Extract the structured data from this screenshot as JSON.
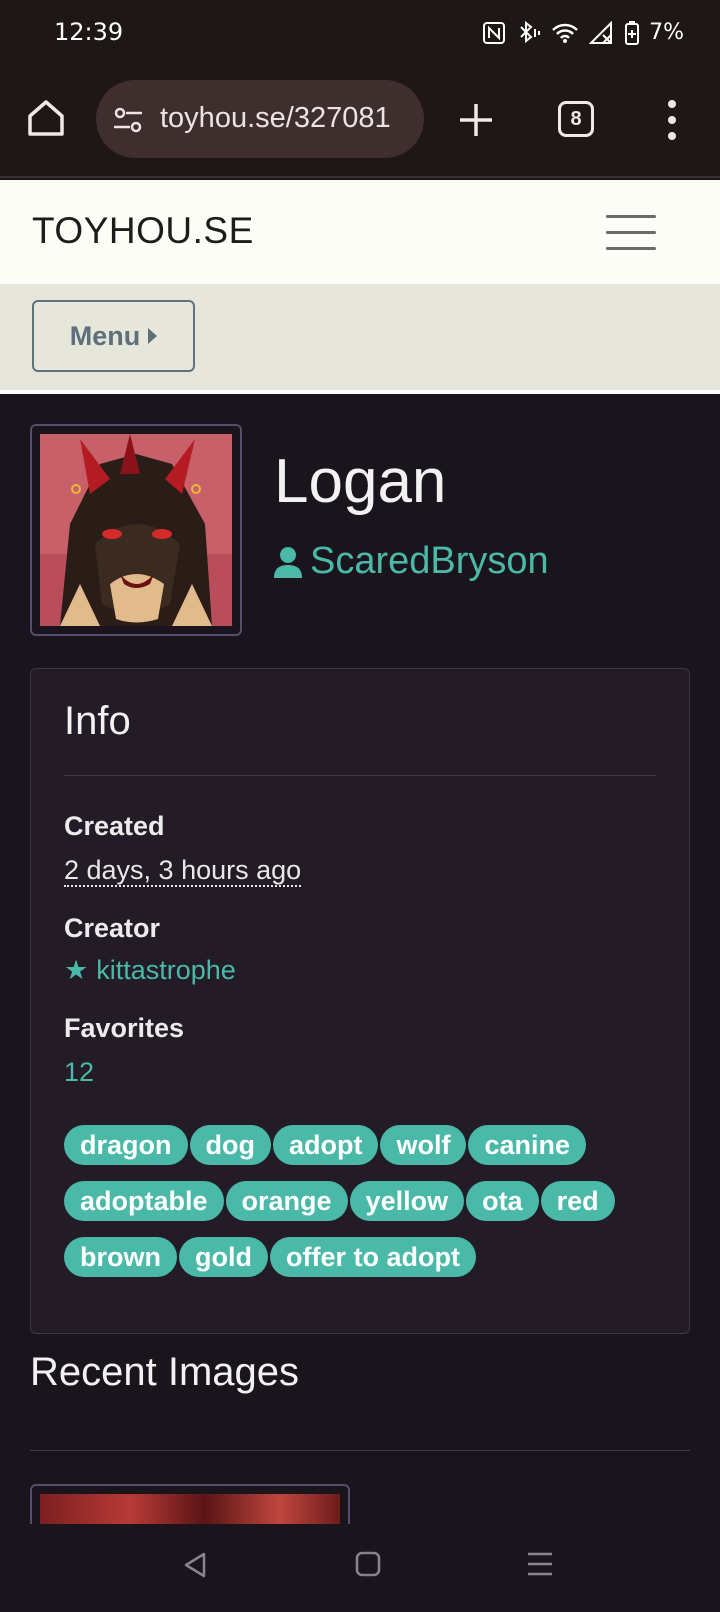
{
  "status": {
    "time": "12:39",
    "battery": "7%"
  },
  "browser": {
    "url": "toyhou.se/327081",
    "tab_count": "8"
  },
  "site": {
    "brand": "TOYHOU.SE",
    "menu_label": "Menu"
  },
  "character": {
    "name": "Logan",
    "owner": "ScaredBryson"
  },
  "info": {
    "title": "Info",
    "created_label": "Created",
    "created_value": "2 days, 3 hours ago",
    "creator_label": "Creator",
    "creator_value": "kittastrophe",
    "favorites_label": "Favorites",
    "favorites_value": "12",
    "tags": [
      [
        "dragon",
        "dog",
        "adopt",
        "wolf",
        "canine"
      ],
      [
        "adoptable",
        "orange",
        "yellow",
        "ota",
        "red"
      ],
      [
        "brown",
        "gold",
        "offer to adopt"
      ]
    ]
  },
  "recent": {
    "title": "Recent Images"
  },
  "colors": {
    "accent": "#4ab9a7",
    "background": "#1a141c",
    "card": "#231b26"
  }
}
